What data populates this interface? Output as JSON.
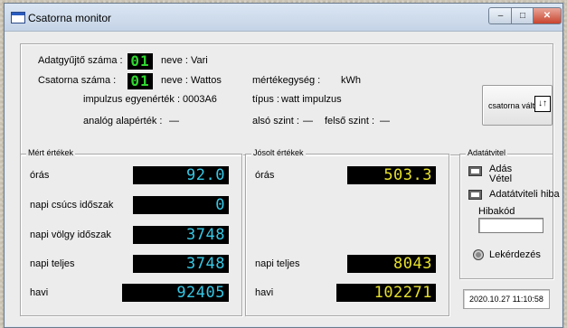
{
  "window": {
    "title": "Csatorna monitor",
    "min": "–",
    "max": "□",
    "close": "✕"
  },
  "info": {
    "collector_label": "Adatgyűjtő száma :",
    "collector_no": "01",
    "collector_name_label": "neve :",
    "collector_name": "Vari",
    "channel_label": "Csatorna száma :",
    "channel_no": "01",
    "channel_name_label": "neve :",
    "channel_name": "Wattos",
    "unit_label": "mértékegység :",
    "unit": "kWh",
    "pulse_label": "impulzus egyenérték :",
    "pulse_value": "0003A6",
    "type_label": "típus :",
    "type_value": "watt impulzus",
    "analog_label": "analóg alapérték :",
    "analog_value": "—",
    "lower_label": "alsó szint :",
    "lower_value": "—",
    "upper_label": "felső szint :",
    "upper_value": "—",
    "switch_button": "csatorna váltás",
    "switch_icon": "↓↑"
  },
  "measured": {
    "title": "Mért értékek",
    "rows": [
      {
        "label": "órás",
        "value": "92.0"
      },
      {
        "label": "napi csúcs időszak",
        "value": "0"
      },
      {
        "label": "napi völgy időszak",
        "value": "3748"
      },
      {
        "label": "napi teljes",
        "value": "3748"
      },
      {
        "label": "havi",
        "value": "92405"
      }
    ]
  },
  "predicted": {
    "title": "Jósolt értékek",
    "rows": [
      {
        "label": "órás",
        "value": "503.3"
      },
      {
        "label": "napi teljes",
        "value": "8043"
      },
      {
        "label": "havi",
        "value": "102271"
      }
    ]
  },
  "transfer": {
    "title": "Adatátvitel",
    "send": "Adás",
    "receive": "Vétel",
    "error": "Adatátviteli hiba",
    "code_label": "Hibakód",
    "code_value": "",
    "query": "Lekérdezés",
    "datetime": "2020.10.27  11:10:58"
  },
  "colors": {
    "led_green": "#2fd62f",
    "lcd_cyan": "#34c8e6",
    "lcd_yellow": "#e6e02a"
  }
}
